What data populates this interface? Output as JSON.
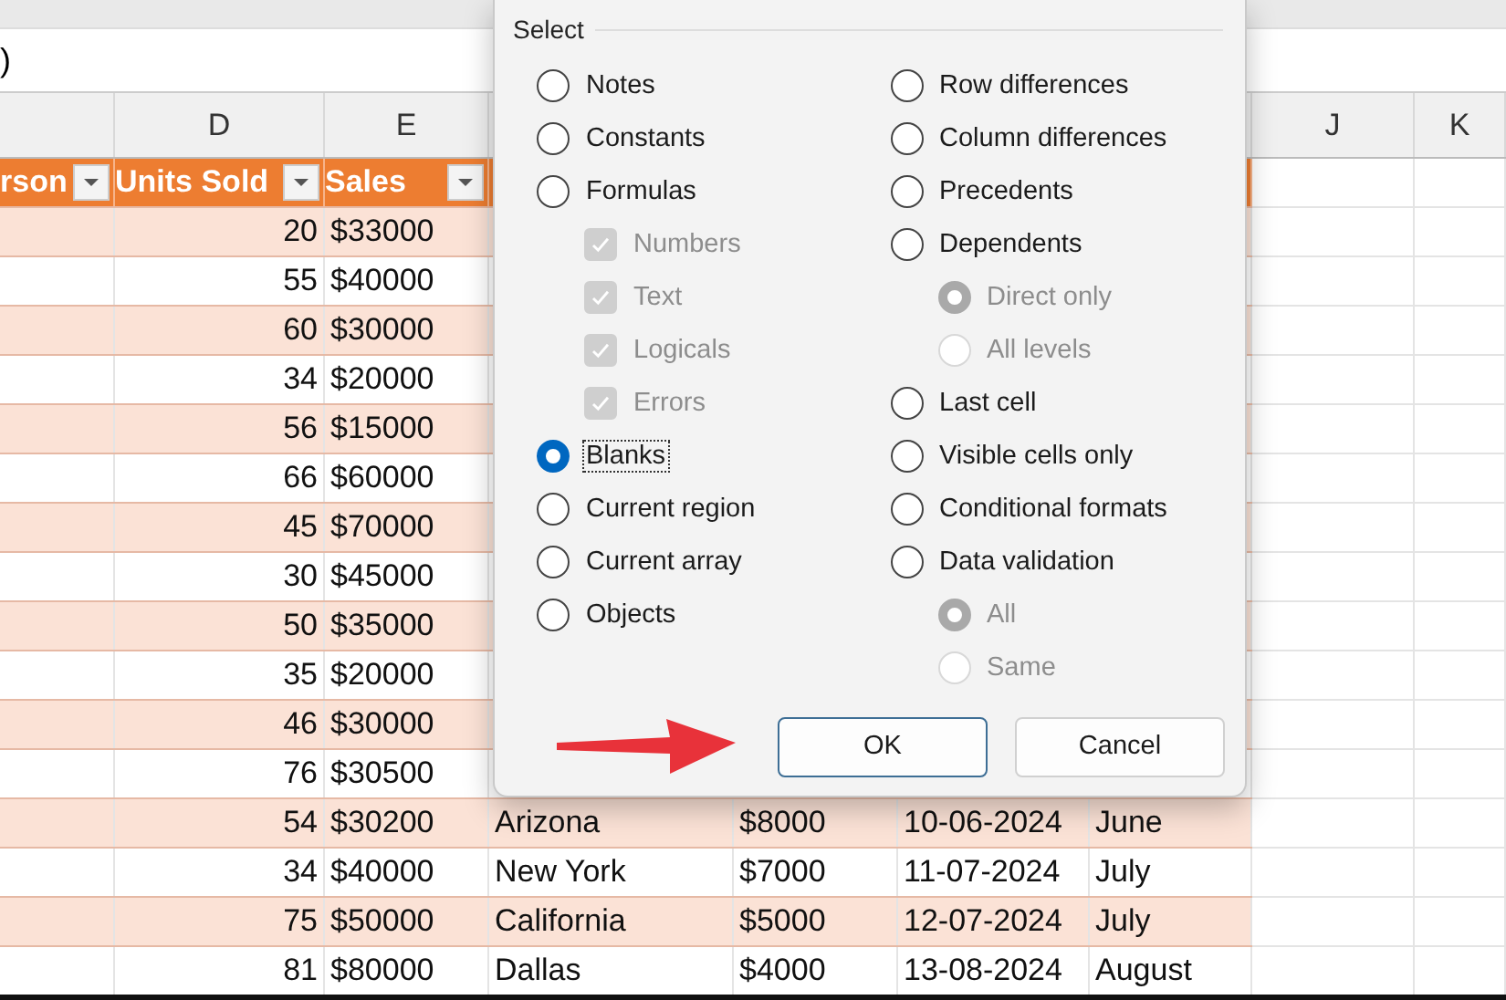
{
  "formula_bar": {
    "text": ")"
  },
  "column_letters": [
    {
      "label": "D"
    },
    {
      "label": "E"
    },
    {
      "label": "J"
    },
    {
      "label": "K"
    }
  ],
  "table": {
    "columns": [
      "rson",
      "Units Sold",
      "Sales"
    ],
    "rows": [
      {
        "units": "20",
        "sales": "$33000"
      },
      {
        "units": "55",
        "sales": "$40000"
      },
      {
        "units": "60",
        "sales": "$30000"
      },
      {
        "units": "34",
        "sales": "$20000"
      },
      {
        "units": "56",
        "sales": "$15000"
      },
      {
        "units": "66",
        "sales": "$60000"
      },
      {
        "units": "45",
        "sales": "$70000"
      },
      {
        "units": "30",
        "sales": "$45000"
      },
      {
        "units": "50",
        "sales": "$35000"
      },
      {
        "units": "35",
        "sales": "$20000"
      },
      {
        "units": "46",
        "sales": "$30000"
      },
      {
        "units": "76",
        "sales": "$30500"
      },
      {
        "units": "54",
        "sales": "$30200",
        "region": "Arizona",
        "amount": "$8000",
        "date": "10-06-2024",
        "month": "June"
      },
      {
        "units": "34",
        "sales": "$40000",
        "region": "New York",
        "amount": "$7000",
        "date": "11-07-2024",
        "month": "July"
      },
      {
        "units": "75",
        "sales": "$50000",
        "region": "California",
        "amount": "$5000",
        "date": "12-07-2024",
        "month": "July"
      },
      {
        "units": "81",
        "sales": "$80000",
        "region": "Dallas",
        "amount": "$4000",
        "date": "13-08-2024",
        "month": "August"
      }
    ]
  },
  "dialog": {
    "group_label": "Select",
    "columns": [
      [
        {
          "kind": "radio",
          "label": "Notes",
          "selected": false
        },
        {
          "kind": "radio",
          "label": "Constants",
          "selected": false
        },
        {
          "kind": "radio",
          "label": "Formulas",
          "selected": false,
          "children": [
            {
              "kind": "checkbox",
              "label": "Numbers",
              "checked": true,
              "disabled": true
            },
            {
              "kind": "checkbox",
              "label": "Text",
              "checked": true,
              "disabled": true
            },
            {
              "kind": "checkbox",
              "label": "Logicals",
              "checked": true,
              "disabled": true
            },
            {
              "kind": "checkbox",
              "label": "Errors",
              "checked": true,
              "disabled": true
            }
          ]
        },
        {
          "kind": "radio",
          "label": "Blanks",
          "selected": true
        },
        {
          "kind": "radio",
          "label": "Current region",
          "selected": false
        },
        {
          "kind": "radio",
          "label": "Current array",
          "selected": false
        },
        {
          "kind": "radio",
          "label": "Objects",
          "selected": false
        }
      ],
      [
        {
          "kind": "radio",
          "label": "Row differences",
          "selected": false
        },
        {
          "kind": "radio",
          "label": "Column differences",
          "selected": false
        },
        {
          "kind": "radio",
          "label": "Precedents",
          "selected": false
        },
        {
          "kind": "radio",
          "label": "Dependents",
          "selected": false,
          "children": [
            {
              "kind": "radio",
              "label": "Direct only",
              "selected": true,
              "disabled": true
            },
            {
              "kind": "radio",
              "label": "All levels",
              "selected": false,
              "disabled": true
            }
          ]
        },
        {
          "kind": "radio",
          "label": "Last cell",
          "selected": false
        },
        {
          "kind": "radio",
          "label": "Visible cells only",
          "selected": false
        },
        {
          "kind": "radio",
          "label": "Conditional formats",
          "selected": false
        },
        {
          "kind": "radio",
          "label": "Data validation",
          "selected": false,
          "children": [
            {
              "kind": "radio",
              "label": "All",
              "selected": true,
              "disabled": true
            },
            {
              "kind": "radio",
              "label": "Same",
              "selected": false,
              "disabled": true
            }
          ]
        }
      ]
    ],
    "buttons": [
      "OK",
      "Cancel"
    ]
  }
}
